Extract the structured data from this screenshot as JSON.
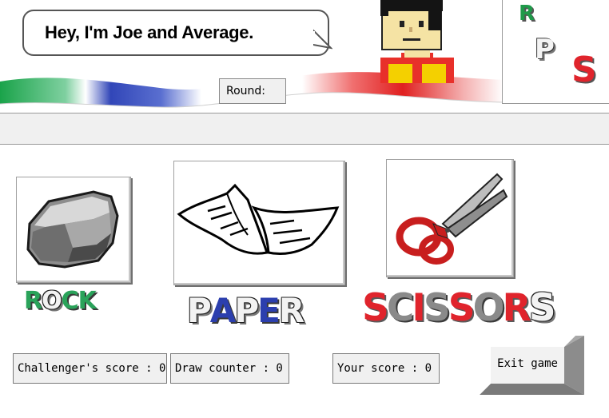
{
  "header": {
    "speech_text": "Hey, I'm Joe and Average.",
    "round_label": "Round:",
    "round_value": ""
  },
  "logo": {
    "letters": [
      "R",
      "P",
      "S"
    ]
  },
  "status_text": "",
  "choices": {
    "rock_letters": [
      "R",
      "O",
      "C",
      "K"
    ],
    "paper_letters": [
      "P",
      "A",
      "P",
      "E",
      "R"
    ],
    "scissors_letters": [
      "S",
      "C",
      "I",
      "S",
      "S",
      "O",
      "R",
      "S"
    ]
  },
  "scores": {
    "challenger": "Challenger's score : 0",
    "draw": "Draw counter : 0",
    "yours": "Your score : 0"
  },
  "exit_label": "Exit game",
  "colors": {
    "green": "#2aa35a",
    "blue": "#2c3fae",
    "red": "#e0242c",
    "panel_gray": "#f0f0f0"
  },
  "icons": [
    "rock-icon",
    "paper-icon",
    "scissors-icon",
    "opponent-avatar"
  ]
}
